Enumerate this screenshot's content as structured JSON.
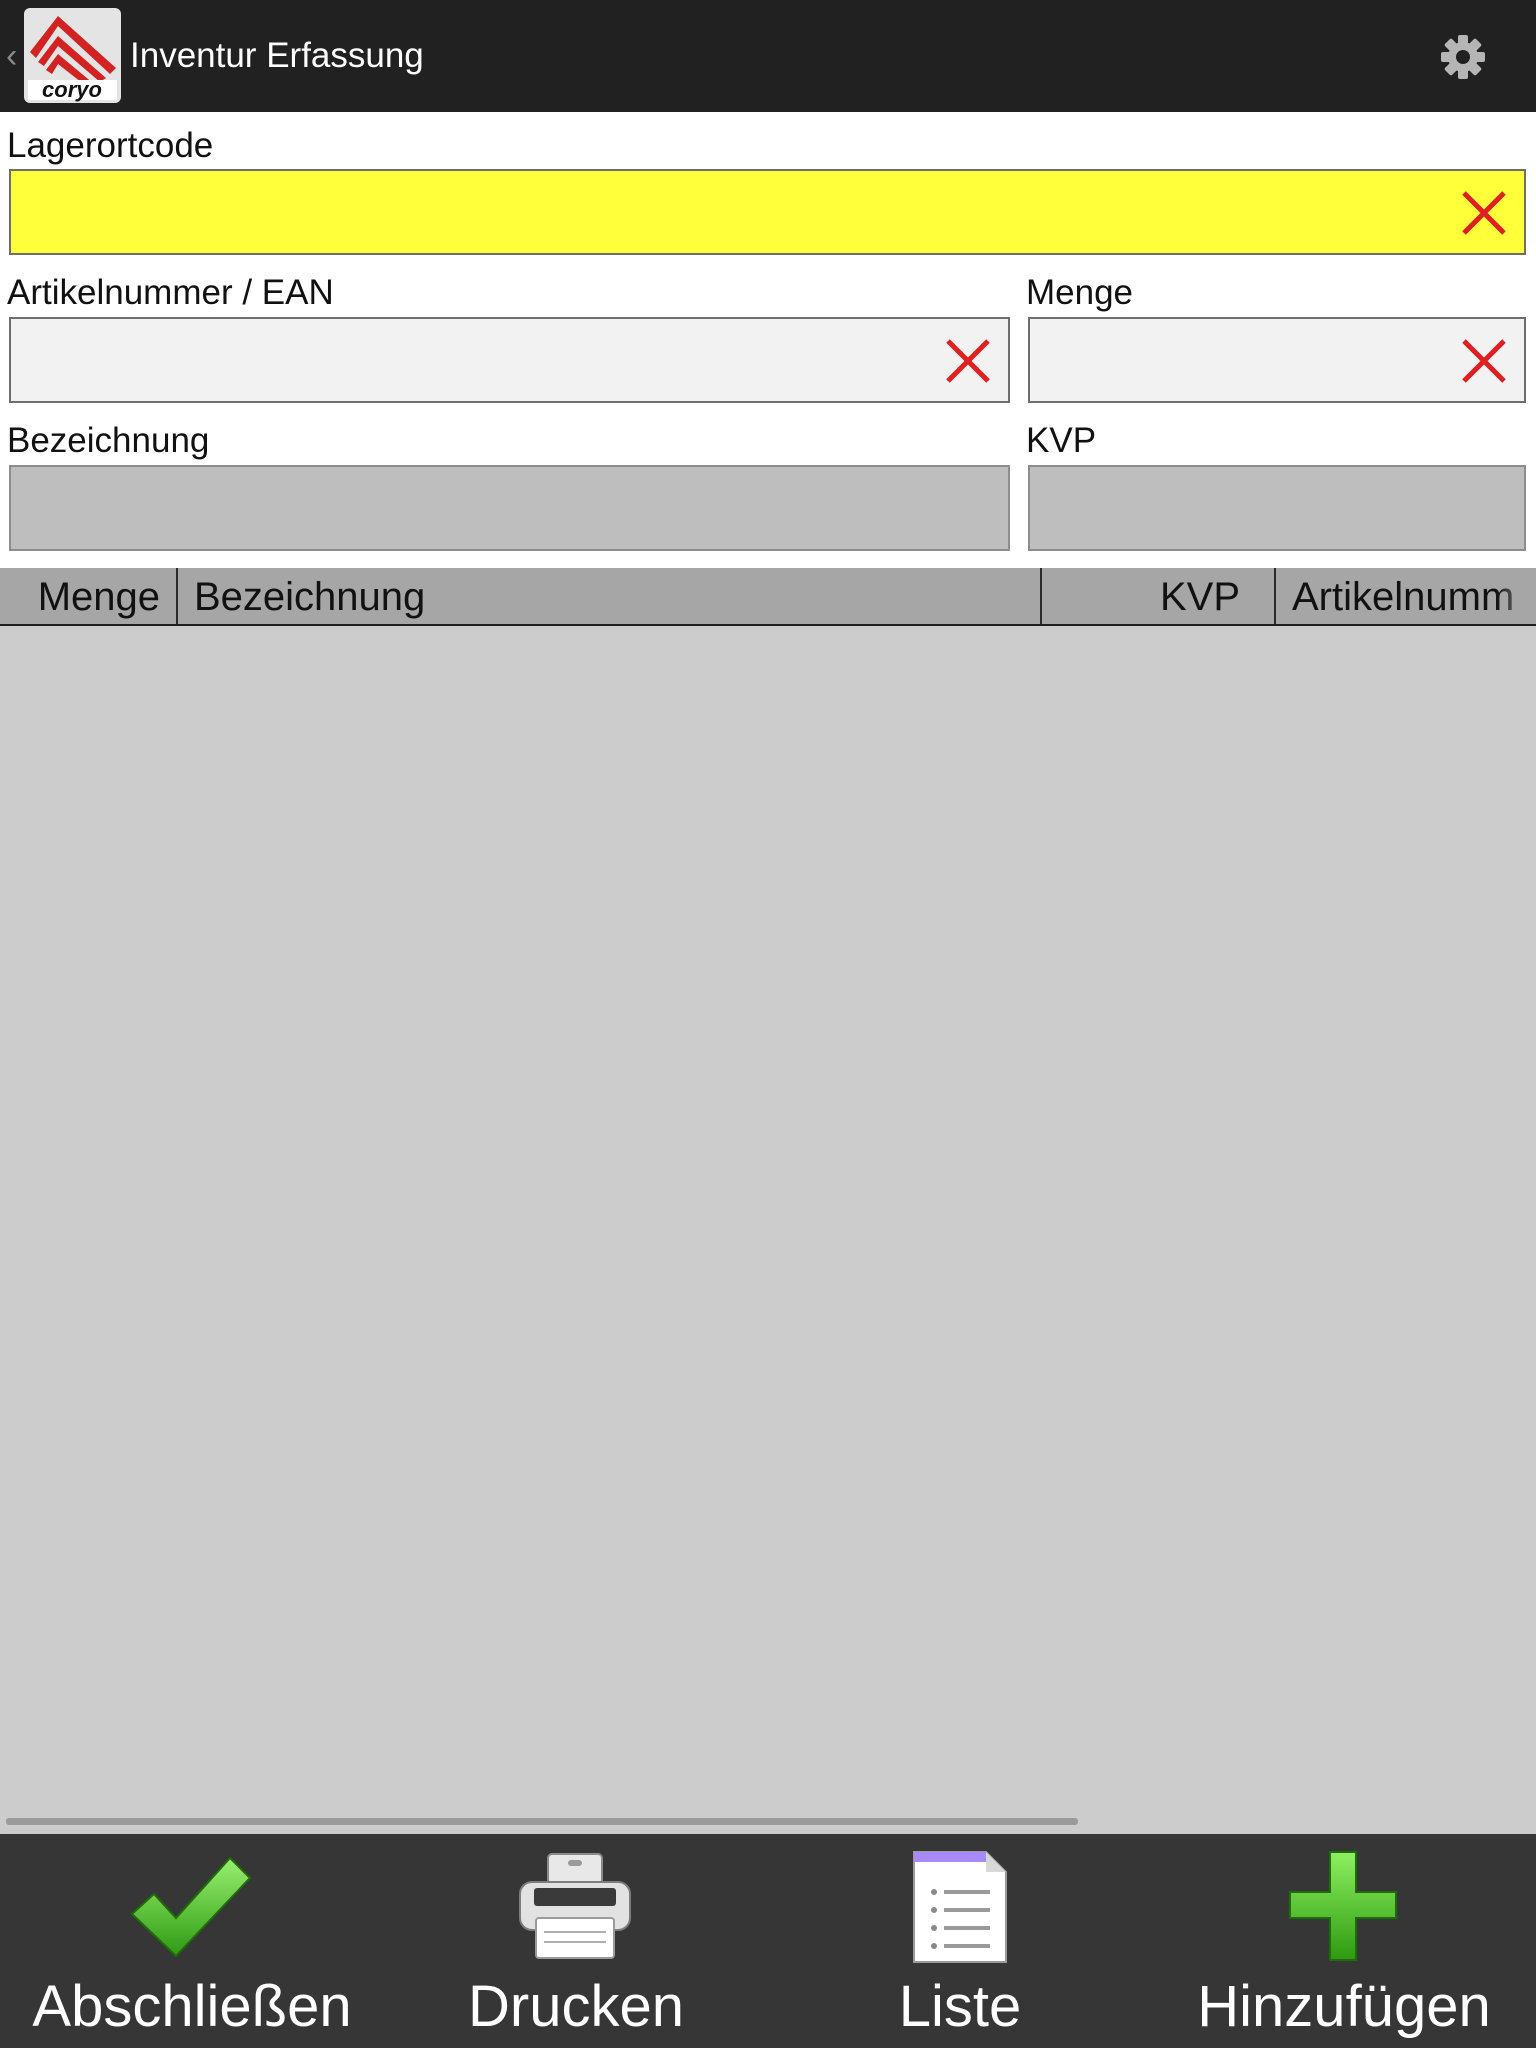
{
  "actionbar": {
    "title": "Inventur Erfassung",
    "back_icon": "chevron-left-icon",
    "logo_text": "coryo",
    "settings_icon": "gear-icon"
  },
  "form": {
    "lagerortcode": {
      "label": "Lagerortcode",
      "value": "",
      "color": "#ffff3a"
    },
    "artikelnummer": {
      "label": "Artikelnummer / EAN",
      "value": ""
    },
    "menge": {
      "label": "Menge",
      "value": ""
    },
    "bezeichnung": {
      "label": "Bezeichnung",
      "value": ""
    },
    "kvp": {
      "label": "KVP",
      "value": ""
    },
    "clear_icon": "clear-x-icon"
  },
  "table": {
    "columns": [
      "Menge",
      "Bezeichnung",
      "KVP",
      "Artikelnumm"
    ],
    "rows": []
  },
  "bottom_actions": [
    {
      "label": "Abschließen",
      "icon": "checkmark-icon"
    },
    {
      "label": "Drucken",
      "icon": "printer-icon"
    },
    {
      "label": "Liste",
      "icon": "document-list-icon"
    },
    {
      "label": "Hinzufügen",
      "icon": "plus-icon"
    }
  ],
  "colors": {
    "actionbar": "#212121",
    "clear_red": "#e02020",
    "table_body": "#cccccc",
    "bottombar": "#363636",
    "check_green": "#44bb22"
  }
}
